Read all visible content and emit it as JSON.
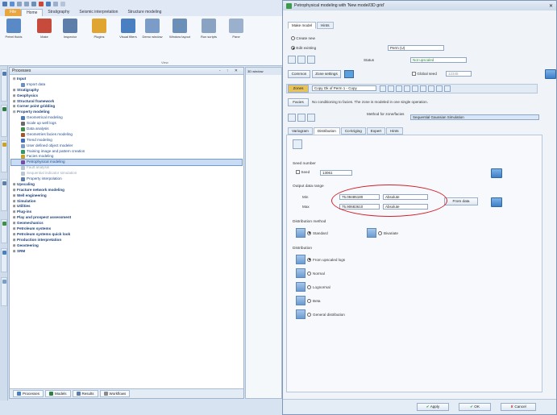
{
  "app": {
    "ribbon_tabs": [
      "File",
      "Home",
      "Stratigraphy",
      "Seismic interpretation",
      "Structure modeling"
    ],
    "ribbon_buttons": [
      {
        "label": "Petrel fluids",
        "icon": "table-icon",
        "color": "#5a8ac6"
      },
      {
        "label": "Make",
        "icon": "camera-icon",
        "color": "#c74b3c"
      },
      {
        "label": "Inspector",
        "icon": "inspect-icon",
        "color": "#5d7ea8"
      },
      {
        "label": "Plugins",
        "icon": "plugin-icon",
        "color": "#e0a531"
      },
      {
        "label": "Visual filters",
        "icon": "filter-icon",
        "color": "#4a7fc1"
      },
      {
        "label": "Demo window",
        "icon": "window-icon",
        "color": "#7a9cc6"
      },
      {
        "label": "Window layout",
        "icon": "layout-icon",
        "color": "#6c8fb8"
      },
      {
        "label": "Run scripts",
        "icon": "script-icon",
        "color": "#8aa3c2"
      },
      {
        "label": "Pane",
        "icon": "pane-icon",
        "color": "#9ab0cc"
      }
    ],
    "ribbon_group": "View",
    "panel_title": "Processes",
    "panel_controls": "- ↑ ✕",
    "tree": [
      {
        "label": "Input",
        "level": 0,
        "expand": "⊟"
      },
      {
        "label": "Import data",
        "level": 1,
        "icon_color": "#6a8fc0"
      },
      {
        "label": "Stratigraphy",
        "level": 0,
        "expand": "⊞"
      },
      {
        "label": "Geophysics",
        "level": 0,
        "expand": "⊞"
      },
      {
        "label": "Structural framework",
        "level": 0,
        "expand": "⊞"
      },
      {
        "label": "Corner point gridding",
        "level": 0,
        "expand": "⊞"
      },
      {
        "label": "Property modeling",
        "level": 0,
        "expand": "⊟"
      },
      {
        "label": "Geometrical modeling",
        "level": 1,
        "icon_color": "#4f7ab5"
      },
      {
        "label": "Scale up well logs",
        "level": 1,
        "icon_color": "#6b6b6b"
      },
      {
        "label": "Data analysis",
        "level": 1,
        "icon_color": "#3d8f49"
      },
      {
        "label": "Geometries facies modeling",
        "level": 1,
        "icon_color": "#9c5a2e"
      },
      {
        "label": "Trend modeling",
        "level": 1,
        "icon_color": "#3f6fbd"
      },
      {
        "label": "User defined object modeler",
        "level": 1,
        "icon_color": "#7c9ccc"
      },
      {
        "label": "Training image and pattern creation",
        "level": 1,
        "icon_color": "#2f9a62"
      },
      {
        "label": "Facies modeling",
        "level": 1,
        "icon_color": "#c9a227"
      },
      {
        "label": "Petrophysical modeling",
        "level": 1,
        "icon_color": "#7a4ea8",
        "selected": true
      },
      {
        "label": "Fault analysis",
        "level": 1,
        "icon_color": "#b9c6d6",
        "dim": true
      },
      {
        "label": "Sequential indicator simulation",
        "level": 1,
        "icon_color": "#b9c6d6",
        "dim": true
      },
      {
        "label": "Property interpolation",
        "level": 1,
        "icon_color": "#5f7fb0"
      },
      {
        "label": "Upscaling",
        "level": 0,
        "expand": "⊞"
      },
      {
        "label": "Fracture network modeling",
        "level": 0,
        "expand": "⊞"
      },
      {
        "label": "Well engineering",
        "level": 0,
        "expand": "⊞"
      },
      {
        "label": "Simulation",
        "level": 0,
        "expand": "⊞"
      },
      {
        "label": "Utilities",
        "level": 0,
        "expand": "⊞"
      },
      {
        "label": "Plug-ins",
        "level": 0,
        "expand": "⊞"
      },
      {
        "label": "Play and prospect assessment",
        "level": 0,
        "expand": "⊞"
      },
      {
        "label": "Geomechanics",
        "level": 0,
        "expand": "⊞"
      },
      {
        "label": "Petroleum systems",
        "level": 0,
        "expand": "⊞"
      },
      {
        "label": "Petroleum systems quick look",
        "level": 0,
        "expand": "⊞"
      },
      {
        "label": "Production interpretation",
        "level": 0,
        "expand": "⊞"
      },
      {
        "label": "Geosteering",
        "level": 0,
        "expand": "⊞"
      },
      {
        "label": "SRM",
        "level": 0,
        "expand": "⊞"
      }
    ],
    "footer_tabs": [
      {
        "label": "Processes",
        "color": "#4a7fc1"
      },
      {
        "label": "Models",
        "color": "#2f7d3f"
      },
      {
        "label": "Results",
        "color": "#5d7ea8"
      },
      {
        "label": "Workflows",
        "color": "#8a8a8a"
      }
    ],
    "bgview_tab": "3D window"
  },
  "dialog": {
    "title": "Petrophysical modeling with 'New model/3D grid'",
    "top_tabs": [
      "Make model",
      "Hints"
    ],
    "create_new": "Create new",
    "edit_existing": "Edit existing",
    "existing_value": "Perm (U)",
    "status_label": "Status",
    "status_value": "Not upscaled",
    "common": "Common",
    "zone_settings": "Zone settings",
    "global_seed": "Global seed",
    "global_seed_value": "12345",
    "zones_btn": "Zones",
    "zones_value": "Copy Ok of Perm 1 - Copy",
    "method_label": "Method for zone/facies",
    "method_value": "Sequential Gaussian Simulation",
    "facies": "Facies",
    "facies_text": "No conditioning to facies. The zone is modeled in one single operation.",
    "sub_tabs": [
      "Variogram",
      "Distribution",
      "Co-kriging",
      "Expert",
      "Hints"
    ],
    "seed_section": "Seed number",
    "seed_label": "Seed",
    "seed_value": "13061",
    "output_section": "Output data range",
    "min_label": "Min",
    "min_value": "75.09485180",
    "max_label": "Max",
    "max_value": "75.90683610",
    "absolute": "Absolute",
    "from_data": "From data",
    "dist_method_section": "Distribution method",
    "standard": "Standard",
    "bivariate": "Bivariate",
    "distribution_section": "Distribution",
    "dist_options": [
      "From upscaled logs",
      "Normal",
      "Lognormal",
      "Beta",
      "General distribution"
    ],
    "apply": "Apply",
    "ok": "OK",
    "cancel": "Cancel"
  }
}
